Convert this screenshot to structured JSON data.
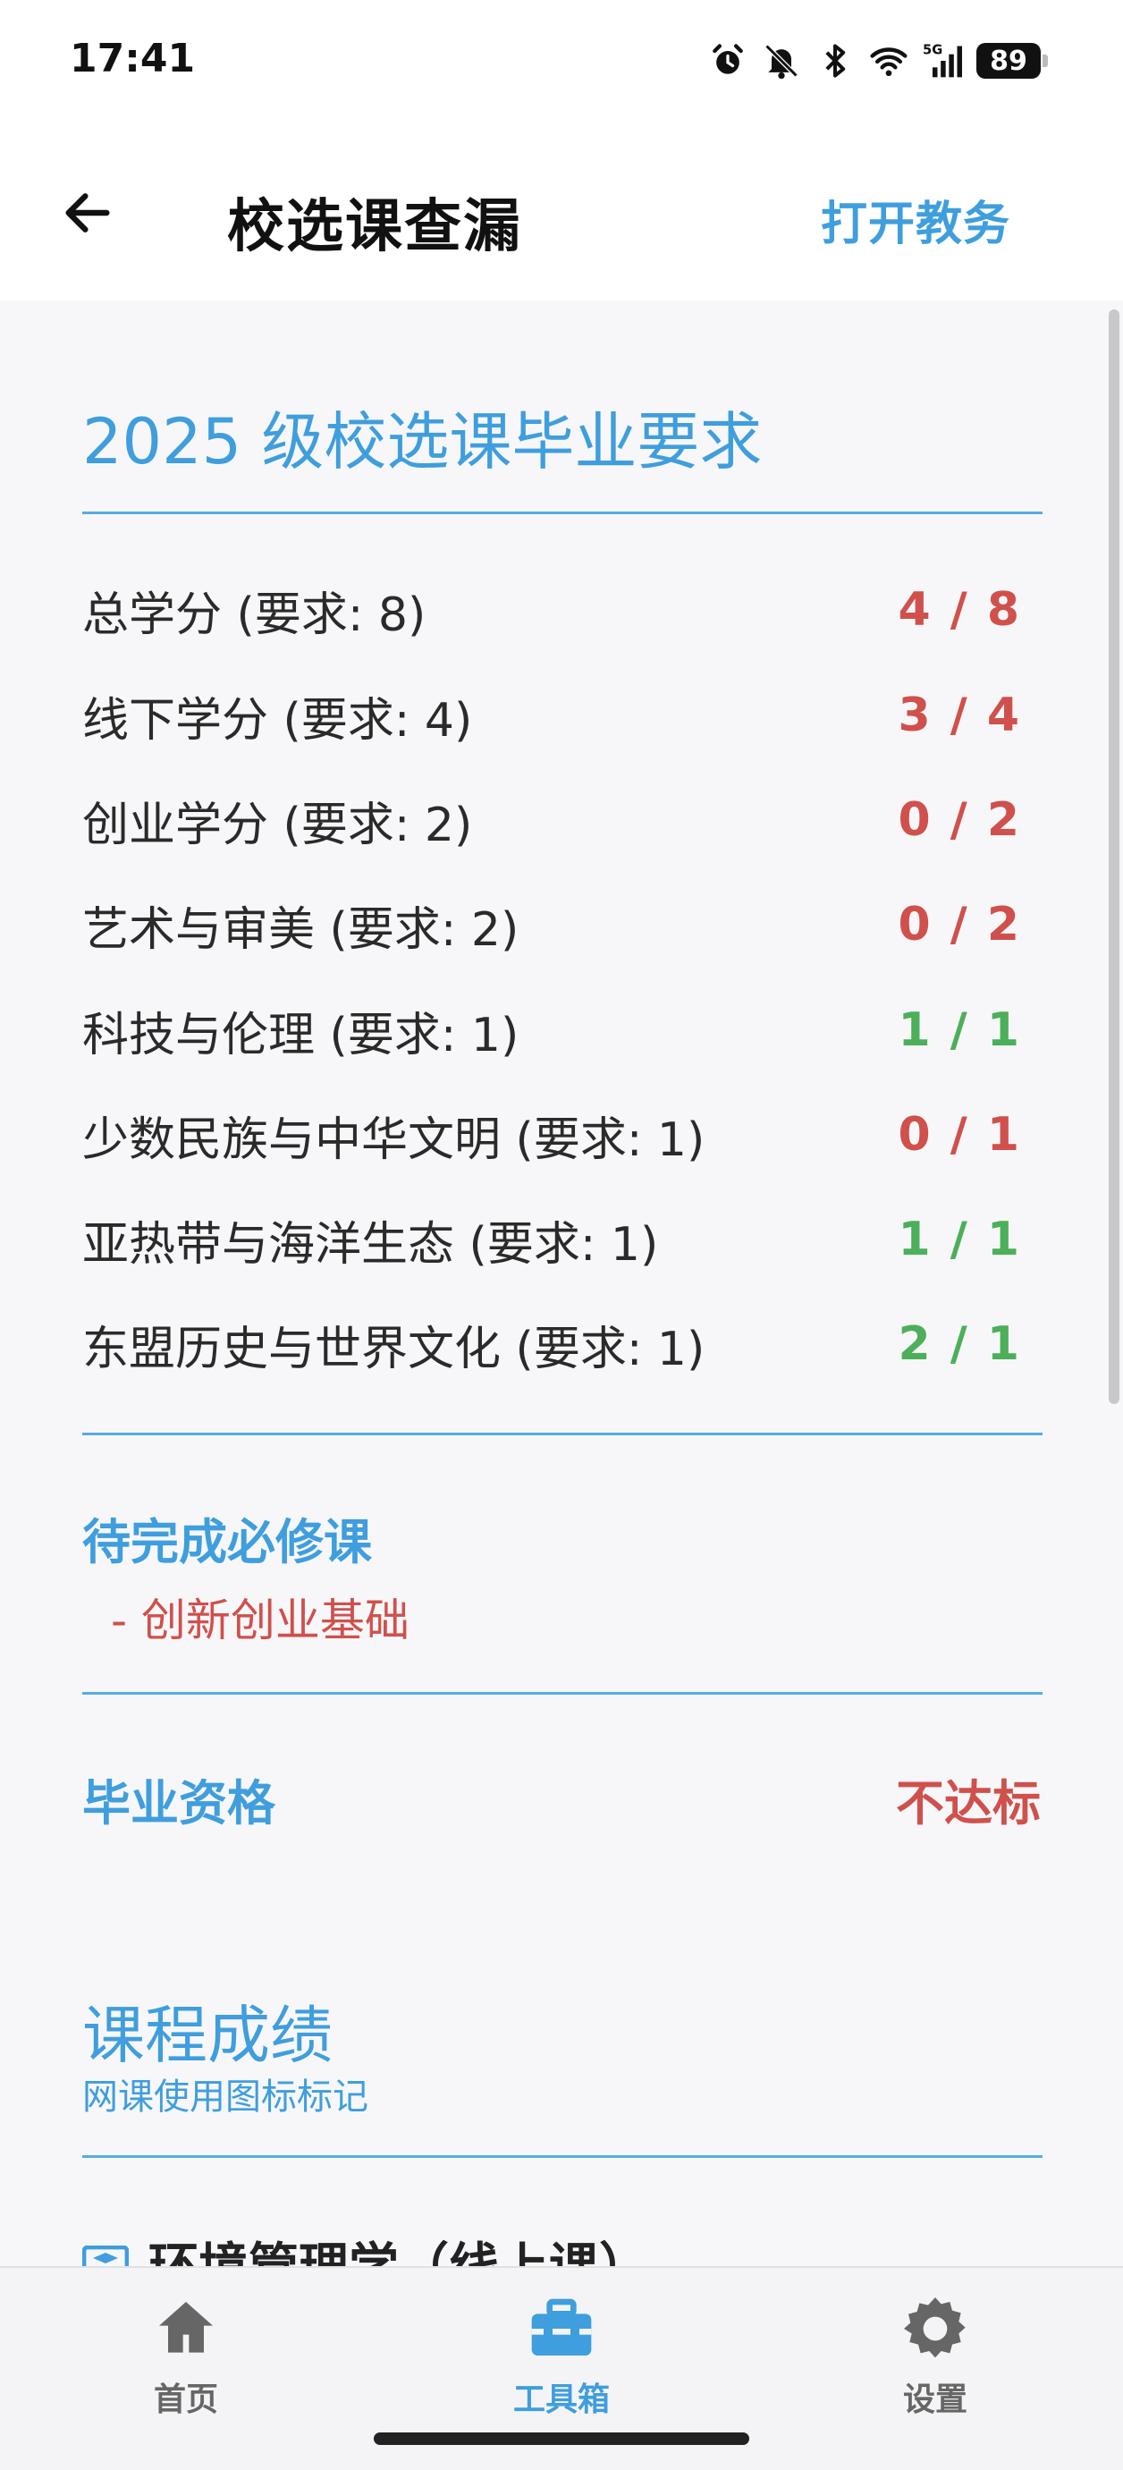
{
  "status_bar": {
    "time": "17:41",
    "battery": "89",
    "icons": [
      "alarm-icon",
      "bell-off-icon",
      "bluetooth-icon",
      "wifi-icon",
      "5g-signal-icon",
      "battery-icon"
    ]
  },
  "appbar": {
    "title": "校选课查漏",
    "action": "打开教务"
  },
  "requirements": {
    "title": "2025 级校选课毕业要求",
    "rows": [
      {
        "label": "总学分 (要求: 8)",
        "value": "4 / 8",
        "status": "red"
      },
      {
        "label": "线下学分 (要求: 4)",
        "value": "3 / 4",
        "status": "red"
      },
      {
        "label": "创业学分 (要求: 2)",
        "value": "0 / 2",
        "status": "red"
      },
      {
        "label": "艺术与审美 (要求: 2)",
        "value": "0 / 2",
        "status": "red"
      },
      {
        "label": "科技与伦理 (要求: 1)",
        "value": "1 / 1",
        "status": "green"
      },
      {
        "label": "少数民族与中华文明 (要求: 1)",
        "value": "0 / 1",
        "status": "red"
      },
      {
        "label": "亚热带与海洋生态 (要求: 1)",
        "value": "1 / 1",
        "status": "green"
      },
      {
        "label": "东盟历史与世界文化 (要求: 1)",
        "value": "2 / 1",
        "status": "green"
      }
    ]
  },
  "pending": {
    "title": "待完成必修课",
    "items": [
      "- 创新创业基础"
    ]
  },
  "graduation": {
    "label": "毕业资格",
    "status": "不达标"
  },
  "grades": {
    "title": "课程成绩",
    "subtitle": "网课使用图标标记",
    "first_course": "环境管理学（线上课）"
  },
  "bottom_nav": {
    "items": [
      {
        "label": "首页",
        "icon": "home-icon",
        "active": false
      },
      {
        "label": "工具箱",
        "icon": "toolbox-icon",
        "active": true
      },
      {
        "label": "设置",
        "icon": "gear-icon",
        "active": false
      }
    ]
  },
  "colors": {
    "accent": "#3f9edd",
    "fail": "#d0504c",
    "pass": "#4caf5a"
  }
}
